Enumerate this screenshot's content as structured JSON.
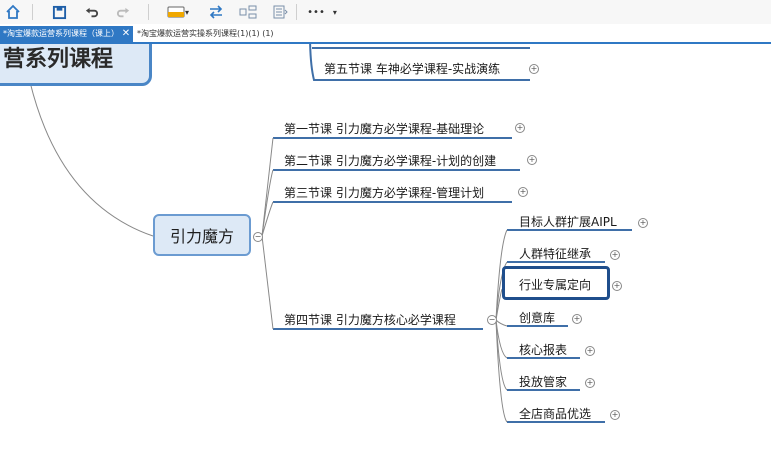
{
  "toolbar": {
    "icons": [
      "home-icon",
      "save-icon",
      "undo-icon",
      "redo-icon",
      "topic-style-icon",
      "swap-icon",
      "layout-icon",
      "outline-icon",
      "more-icon"
    ],
    "more_label": "•••"
  },
  "tabs": [
    {
      "label": "*淘宝爆款运营系列课程（课上）",
      "active": true
    },
    {
      "label": "*淘宝爆款运营实操系列课程(1)(1) (1)",
      "active": false
    }
  ],
  "mindmap": {
    "root_label": "营系列课程",
    "top_branch": {
      "label": "第五节课 车神必学课程-实战演练"
    },
    "main_topic": "引力魔方",
    "lessons": [
      "第一节课 引力魔方必学课程-基础理论",
      "第二节课 引力魔方必学课程-计划的创建",
      "第三节课  引力魔方必学课程-管理计划",
      "第四节课  引力魔方核心必学课程"
    ],
    "sub_topics": [
      "目标人群扩展AIPL",
      "人群特征继承",
      "行业专属定向",
      "创意库",
      "核心报表",
      "投放管家",
      "全店商品优选"
    ],
    "selected": "行业专属定向"
  },
  "colors": {
    "accent": "#2f78c4",
    "line": "#3f6fa8",
    "node_fill": "#dde9f6",
    "node_border": "#4a86c6"
  }
}
